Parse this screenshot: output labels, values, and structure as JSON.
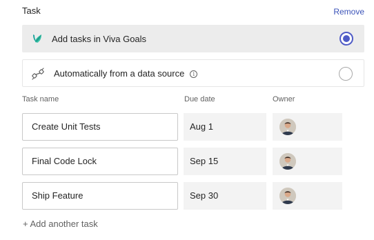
{
  "section": {
    "title": "Task",
    "remove_label": "Remove"
  },
  "options": [
    {
      "label": "Add tasks in Viva Goals",
      "icon": "viva-goals-logo-icon",
      "selected": true
    },
    {
      "label": "Automatically from a data source",
      "icon": "link-connector-icon",
      "info_icon": "info-icon",
      "info_glyph": "i",
      "selected": false
    }
  ],
  "columns": {
    "task_name": "Task name",
    "due_date": "Due date",
    "owner": "Owner"
  },
  "tasks": [
    {
      "name": "Create Unit Tests",
      "due": "Aug 1",
      "owner_icon": "avatar"
    },
    {
      "name": "Final Code Lock",
      "due": "Sep 15",
      "owner_icon": "avatar"
    },
    {
      "name": "Ship Feature",
      "due": "Sep 30",
      "owner_icon": "avatar"
    }
  ],
  "add_task_label": "+ Add another task",
  "colors": {
    "accent": "#4f5bc6",
    "link": "#3a52b8",
    "selected_bg": "#ececec",
    "cell_bg": "#f3f3f3",
    "brand_teal": "#1aa39a"
  }
}
